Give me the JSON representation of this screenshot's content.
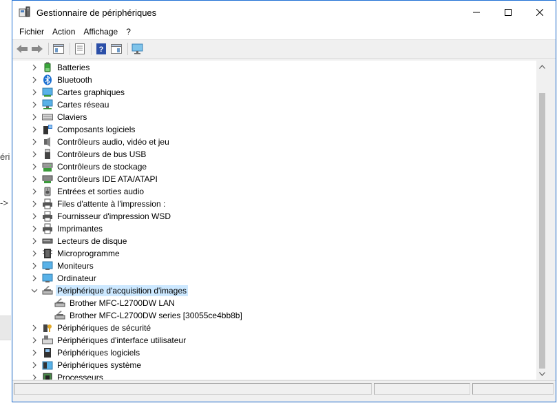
{
  "background": {
    "fragment_1": "éri",
    "fragment_2": "->"
  },
  "window": {
    "title": "Gestionnaire de périphériques",
    "controls": {
      "minimize": "–",
      "maximize": "□",
      "close": "✕"
    }
  },
  "menu": {
    "items": [
      "Fichier",
      "Action",
      "Affichage",
      "?"
    ]
  },
  "toolbar": {
    "buttons": [
      "back-icon",
      "forward-icon",
      "console-tree-icon",
      "properties-icon",
      "help-icon",
      "view-icon",
      "monitor-icon"
    ]
  },
  "tree": {
    "categories": [
      {
        "label": "Batteries",
        "icon": "battery-icon",
        "expanded": false
      },
      {
        "label": "Bluetooth",
        "icon": "bluetooth-icon",
        "expanded": false
      },
      {
        "label": "Cartes graphiques",
        "icon": "display-adapter-icon",
        "expanded": false
      },
      {
        "label": "Cartes réseau",
        "icon": "network-adapter-icon",
        "expanded": false
      },
      {
        "label": "Claviers",
        "icon": "keyboard-icon",
        "expanded": false
      },
      {
        "label": "Composants logiciels",
        "icon": "software-component-icon",
        "expanded": false
      },
      {
        "label": "Contrôleurs audio, vidéo et jeu",
        "icon": "audio-icon",
        "expanded": false
      },
      {
        "label": "Contrôleurs de bus USB",
        "icon": "usb-icon",
        "expanded": false
      },
      {
        "label": "Contrôleurs de stockage",
        "icon": "storage-icon",
        "expanded": false
      },
      {
        "label": "Contrôleurs IDE ATA/ATAPI",
        "icon": "ide-icon",
        "expanded": false
      },
      {
        "label": "Entrées et sorties audio",
        "icon": "speaker-icon",
        "expanded": false
      },
      {
        "label": "Files d'attente à l'impression :",
        "icon": "print-queue-icon",
        "expanded": false
      },
      {
        "label": "Fournisseur d'impression WSD",
        "icon": "wsd-printer-icon",
        "expanded": false
      },
      {
        "label": "Imprimantes",
        "icon": "printer-icon",
        "expanded": false
      },
      {
        "label": "Lecteurs de disque",
        "icon": "disk-drive-icon",
        "expanded": false
      },
      {
        "label": "Microprogramme",
        "icon": "firmware-icon",
        "expanded": false
      },
      {
        "label": "Moniteurs",
        "icon": "monitor-icon",
        "expanded": false
      },
      {
        "label": "Ordinateur",
        "icon": "computer-icon",
        "expanded": false
      },
      {
        "label": "Périphérique d'acquisition d'images",
        "icon": "imaging-device-icon",
        "expanded": true,
        "selected": true,
        "children": [
          {
            "label": "Brother MFC-L2700DW LAN",
            "icon": "scanner-icon"
          },
          {
            "label": "Brother MFC-L2700DW series [30055ce4bb8b]",
            "icon": "scanner-icon"
          }
        ]
      },
      {
        "label": "Périphériques de sécurité",
        "icon": "security-device-icon",
        "expanded": false
      },
      {
        "label": "Périphériques d'interface utilisateur",
        "icon": "hid-icon",
        "expanded": false
      },
      {
        "label": "Périphériques logiciels",
        "icon": "software-device-icon",
        "expanded": false
      },
      {
        "label": "Périphériques système",
        "icon": "system-device-icon",
        "expanded": false
      },
      {
        "label": "Processeurs",
        "icon": "processor-icon",
        "expanded": false
      }
    ]
  },
  "colors": {
    "selection": "#cce8ff",
    "window_border": "#1e6fd4",
    "chevron": "#555555"
  }
}
